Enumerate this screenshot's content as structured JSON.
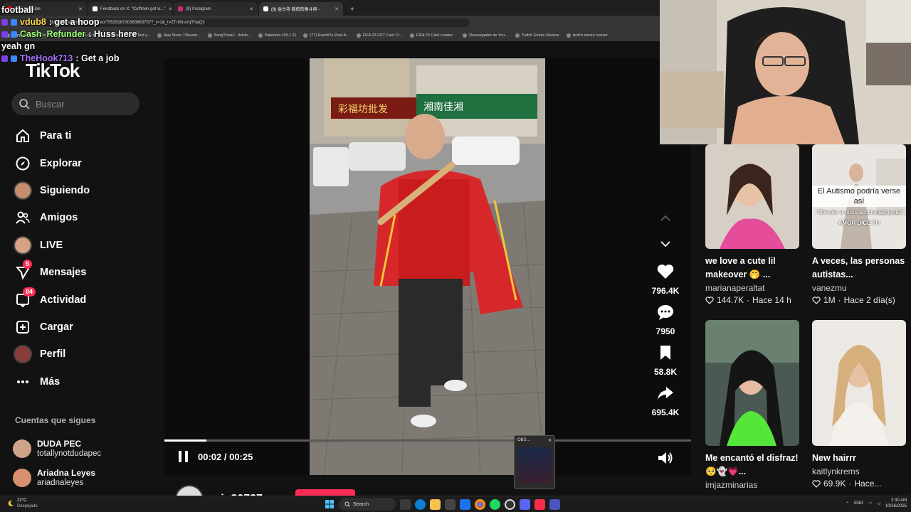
{
  "browser": {
    "tabs": [
      {
        "label": "(39) YouTube",
        "active": false,
        "color": "#ff0000"
      },
      {
        "label": "Feedback on X: \"Cuffmen got vi...\"",
        "active": false,
        "color": "#ffffff"
      },
      {
        "label": "(8) Instagram",
        "active": false,
        "color": "#d62976"
      },
      {
        "label": "(9) 金台寺 能依的角斗场 -",
        "active": true,
        "color": "#ffffff"
      }
    ],
    "url": "tiktok.com/@min30727/video/7553526730363863757?_r=1&_t=ZT-90rsVqTNaQ3",
    "bookmarks": [
      "Happy Cristiano Ro...",
      "Buragg figura de to...",
      "SongTrivia2 - Test y...",
      "App Store / Stream...",
      "SongTrivia2 - Advin...",
      "Paletools v25.1.11",
      "(77) Razo97s Zest-A...",
      "FIFA 23 FUT Card Cr...",
      "FIFA 23 Card creator...",
      "Descargador de You...",
      "Twitch Emote Resizer",
      "twitch emote resizer"
    ]
  },
  "chat": [
    {
      "user": "",
      "message": "football",
      "color": "#ffffff"
    },
    {
      "user": "vdub8",
      "message": ": get a hoop",
      "color": "#ffd84a"
    },
    {
      "user": "Cash_Refunder",
      "message": ": Huss here",
      "color": "#9cff7a"
    },
    {
      "user": "",
      "message": "yeah gn",
      "color": "#ffffff"
    },
    {
      "user": "TheHook713",
      "message": ": Get a job",
      "color": "#a970ff"
    }
  ],
  "sidebar": {
    "logo": "TikTok",
    "search_placeholder": "Buscar",
    "items": [
      {
        "label": "Para ti",
        "icon": "home-icon"
      },
      {
        "label": "Explorar",
        "icon": "compass-icon"
      },
      {
        "label": "Siguiendo",
        "icon": "following-avatar-icon"
      },
      {
        "label": "Amigos",
        "icon": "friends-icon"
      },
      {
        "label": "LIVE",
        "icon": "live-avatar-icon"
      },
      {
        "label": "Mensajes",
        "icon": "paper-plane-icon",
        "badge": "5"
      },
      {
        "label": "Actividad",
        "icon": "inbox-icon",
        "badge": "84"
      },
      {
        "label": "Cargar",
        "icon": "plus-square-icon"
      },
      {
        "label": "Perfil",
        "icon": "profile-avatar-icon"
      },
      {
        "label": "Más",
        "icon": "more-dots-icon"
      }
    ],
    "following_title": "Cuentas que sigues",
    "following": [
      {
        "name": "DUDA PEC",
        "handle": "totallynotdudapec"
      },
      {
        "name": "Ariadna Leyes",
        "handle": "ariadnaleyes"
      }
    ]
  },
  "player": {
    "time": "00:02 / 00:25",
    "progress": 0.08,
    "author": "min30727",
    "actions": [
      {
        "icon": "heart-icon",
        "count": "796.4K"
      },
      {
        "icon": "comment-icon",
        "count": "7950"
      },
      {
        "icon": "bookmark-icon",
        "count": "58.8K"
      },
      {
        "icon": "share-icon",
        "count": "695.4K"
      }
    ],
    "storefront_signs": [
      "彩福坊批发",
      "湘南佳湘"
    ]
  },
  "obs": {
    "title": "OBS..."
  },
  "recommendations": [
    {
      "title": "we love a cute lil makeover 🤭 ...",
      "author": "marianaperaltat",
      "likes": "144.7K",
      "time": "Hace 14 h",
      "overlay": ""
    },
    {
      "title": "A veces, las personas autistas...",
      "author": "vanezmu",
      "likes": "1M",
      "time": "Hace 2 día(s)",
      "overlay": "El Autismo podría verse así",
      "overlay_small": "*Ofender a otros accidentalmente*",
      "overlay_caption": "AMOR DICE TU"
    },
    {
      "title": "Me encantó el disfraz! 🥺👻💗...",
      "author": "imjazminarias",
      "likes": "",
      "time": "",
      "overlay": ""
    },
    {
      "title": "New hairrr",
      "author": "kaitlynkrems",
      "likes": "69.9K",
      "time": "Hace...",
      "overlay": ""
    }
  ],
  "taskbar": {
    "weather_temp": "22°C",
    "weather_desc": "Despejado",
    "search_label": "Search",
    "language": "ENG",
    "time": "3:30 AM",
    "date": "10/26/2025"
  },
  "colors": {
    "accent": "#fe2c55",
    "background": "#121212"
  }
}
